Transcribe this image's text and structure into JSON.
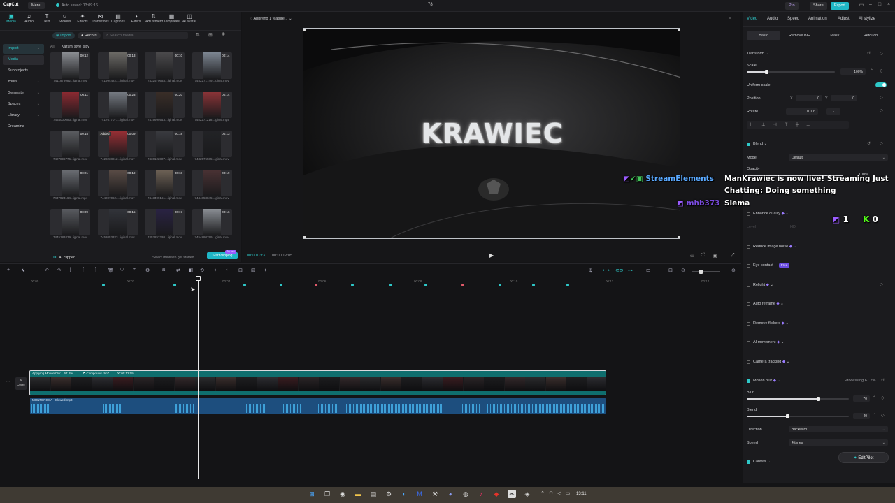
{
  "titlebar": {
    "app": "CapCut",
    "menu": "Menu",
    "autosave": "Auto saved: 13:09:16",
    "project": "78",
    "pro": "Pro",
    "share": "Share",
    "export": "Export"
  },
  "tools": [
    {
      "icon": "media-icon",
      "label": "Media"
    },
    {
      "icon": "audio-icon",
      "label": "Audio"
    },
    {
      "icon": "text-icon",
      "label": "Text"
    },
    {
      "icon": "stickers-icon",
      "label": "Stickers"
    },
    {
      "icon": "effects-icon",
      "label": "Effects"
    },
    {
      "icon": "transitions-icon",
      "label": "Transitions"
    },
    {
      "icon": "captions-icon",
      "label": "Captions"
    },
    {
      "icon": "filters-icon",
      "label": "Filters"
    },
    {
      "icon": "adjustment-icon",
      "label": "Adjustment"
    },
    {
      "icon": "templates-icon",
      "label": "Templates"
    },
    {
      "icon": "ai-avatar-icon",
      "label": "AI avatar"
    }
  ],
  "sidebar": {
    "items": [
      "Import",
      "Media",
      "Subprojects",
      "Yours",
      "Generate",
      "Spaces",
      "Library",
      "Dreamina"
    ]
  },
  "media": {
    "import_btn": "Import",
    "record_btn": "Record",
    "search_placeholder": "Search media",
    "filter_all": "All",
    "folder": "Kazumi style klipy",
    "thumbs": [
      {
        "dur": "00:12",
        "name": "7411979982...iginal.mov",
        "color": "#8a8d92",
        "added": ""
      },
      {
        "dur": "00:13",
        "name": "7419944221...iginal.mov",
        "color": "#6c6a66",
        "added": ""
      },
      {
        "dur": "00:10",
        "name": "7432570633...iginal.mov",
        "color": "#4b4a4c",
        "added": ""
      },
      {
        "dur": "00:14",
        "name": "7452271749...iginal.mov",
        "color": "#7d8692",
        "added": ""
      },
      {
        "dur": "00:11",
        "name": "7464000083...iginal.mov",
        "color": "#8e2a32",
        "added": ""
      },
      {
        "dur": "00:23",
        "name": "7417677071...iginal.mov",
        "color": "#777c84",
        "added": ""
      },
      {
        "dur": "00:20",
        "name": "7419999543...iginal.mov",
        "color": "#3a2e28",
        "added": ""
      },
      {
        "dur": "00:14",
        "name": "7452271218...iginal.mp4",
        "color": "#8c3438",
        "added": ""
      },
      {
        "dur": "00:15",
        "name": "7427896776...iginal.mov",
        "color": "#5c5e62",
        "added": ""
      },
      {
        "dur": "00:09",
        "name": "7428238812...iginal.mov",
        "color": "#9a2f35",
        "added": "Added"
      },
      {
        "dur": "00:18",
        "name": "7430122807...iginal.mov",
        "color": "#3a3b40",
        "added": ""
      },
      {
        "dur": "00:13",
        "name": "7432576585...iginal.mov",
        "color": "#222326",
        "added": ""
      },
      {
        "dur": "00:21",
        "name": "7437923164...iginal.mp4",
        "color": "#6b6e74",
        "added": ""
      },
      {
        "dur": "00:19",
        "name": "7442070624...iginal.mov",
        "color": "#5a4c46",
        "added": ""
      },
      {
        "dur": "00:18",
        "name": "7443499161...iginal.mov",
        "color": "#6e6256",
        "added": ""
      },
      {
        "dur": "00:19",
        "name": "7444858845...iginal.mov",
        "color": "#4a3234",
        "added": ""
      },
      {
        "dur": "00:09",
        "name": "7445183439...iginal.mov",
        "color": "#595b60",
        "added": ""
      },
      {
        "dur": "00:15",
        "name": "7452053323...iginal.mov",
        "color": "#32343a",
        "added": ""
      },
      {
        "dur": "00:17",
        "name": "7453252220...iginal.mov",
        "color": "#2a2344",
        "added": ""
      },
      {
        "dur": "00:16",
        "name": "7454880799...iginal.mov",
        "color": "#8a8e94",
        "added": ""
      }
    ],
    "ai_clipper": "AI clipper",
    "hint": "Select media to get started",
    "start_clipping": "Start clipping",
    "try_free": "Try free"
  },
  "player": {
    "status": "Applying 1 feature...",
    "overlay_text": "KRAWIEC",
    "current_time": "00:00:03:31",
    "total_time": "00:00:12:05"
  },
  "chat": {
    "line1_name": "StreamElements",
    "line1_msg_a": "ManKrawiec is now live! Streaming Just",
    "line1_msg_b": "Chatting: Doing something",
    "line2_name": "mhb373",
    "line2_msg": "Siema",
    "count_a": "1",
    "count_b": "0"
  },
  "inspector": {
    "tabs": [
      "Video",
      "Audio",
      "Speed",
      "Animation",
      "Adjust",
      "AI stylize"
    ],
    "subtabs": [
      "Basic",
      "Remove BG",
      "Mask",
      "Retouch"
    ],
    "transform": "Transform",
    "scale_label": "Scale",
    "scale_value": "100%",
    "scale_fraction": 0.22,
    "uniform_scale": "Uniform scale",
    "position_label": "Position",
    "pos_x_label": "X",
    "pos_x": "0",
    "pos_y_label": "Y",
    "pos_y": "0",
    "rotate_label": "Rotate",
    "rotate_value": "0.00°",
    "rotate_minus": "-",
    "blend": "Blend",
    "mode_label": "Mode",
    "mode_value": "Default",
    "opacity_label": "Opacity",
    "opacity_value": "100%",
    "enhance_quality": "Enhance quality",
    "level_label": "Level",
    "level_value": "HD",
    "reduce_noise": "Reduce image noise",
    "eye_contact": "Eye contact",
    "eye_badge": "Free",
    "relight": "Relight",
    "auto_reframe": "Auto reframe",
    "remove_flickers": "Remove flickers",
    "ai_movement": "AI movement",
    "camera_tracking": "Camera tracking",
    "motion_blur": "Motion blur",
    "processing": "Processing 67.2%",
    "blur_label": "Blur",
    "blur_value": "70",
    "blur_fraction": 0.7,
    "blend2_label": "Blend",
    "blend2_value": "40",
    "blend2_fraction": 0.4,
    "direction_label": "Direction",
    "direction_value": "Backward",
    "speed_label": "Speed",
    "speed_value": "4 times",
    "canvas": "Canvas",
    "editpilot": "EditPilot"
  },
  "timeline": {
    "ruler": [
      "00:00",
      "00:02",
      "00:04",
      "00:06",
      "00:08",
      "00:10",
      "00:12",
      "00:14"
    ],
    "video_clip_label": "Applying Motion blur... 67.2%",
    "compound_label": "Compound clip7",
    "compound_time": "00:00:12:05",
    "cover": "Cover",
    "audio_label": "MONTERGSA - Slowed.mp3"
  },
  "taskbar": {
    "clock": "13:11"
  }
}
